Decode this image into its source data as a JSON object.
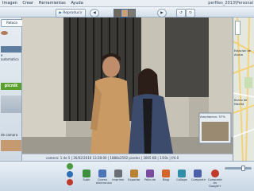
{
  "menubar": {
    "items": [
      "Imagen",
      "Crear",
      "Herramientas",
      "Ayuda"
    ],
    "window_title": "perfiles_2013\\Personal"
  },
  "toolbar": {
    "play_label": "Reproducir",
    "back_icon": "arrow-left-icon",
    "forward_icon": "arrow-right-icon",
    "rotate_left_icon": "rotate-left-icon",
    "rotate_right_icon": "rotate-right-icon"
  },
  "left_panel": {
    "header_button": "Retoca",
    "items": [
      "e automatico",
      "picnik",
      "de camara"
    ]
  },
  "photo": {
    "caption": "Ampliacion: 57%"
  },
  "infobar": {
    "text": "camera: 1 de 5 | 26/02/2010 13:28:00 | 1888x2592 pixeles | 3065 KB | 1/30s | f/4.0"
  },
  "map": {
    "labels": [
      "Estacion de",
      "Alcala",
      "Barrio de",
      "Madrid"
    ]
  },
  "actions": {
    "items": [
      {
        "label": "Subir",
        "icon": "upload-icon",
        "color": "#3e8f3e"
      },
      {
        "label": "Correo electronico",
        "icon": "email-icon",
        "color": "#4a74b5"
      },
      {
        "label": "Imprimir",
        "icon": "print-icon",
        "color": "#6a6f77"
      },
      {
        "label": "Exportar",
        "icon": "export-icon",
        "color": "#b98232"
      },
      {
        "label": "Pelicula",
        "icon": "movie-icon",
        "color": "#7a4aa0"
      },
      {
        "label": "Blog",
        "icon": "blog-icon",
        "color": "#d5642a"
      },
      {
        "label": "Collage",
        "icon": "collage-icon",
        "color": "#2f8fa8"
      },
      {
        "label": "Compartir",
        "icon": "share-icon",
        "color": "#4b5fa8"
      },
      {
        "label": "Compartir en Google+",
        "icon": "google-plus-icon",
        "color": "#c0392b"
      }
    ]
  },
  "colors": {
    "accent": "#2d6eb5",
    "chrome": "#c8d6e4"
  }
}
